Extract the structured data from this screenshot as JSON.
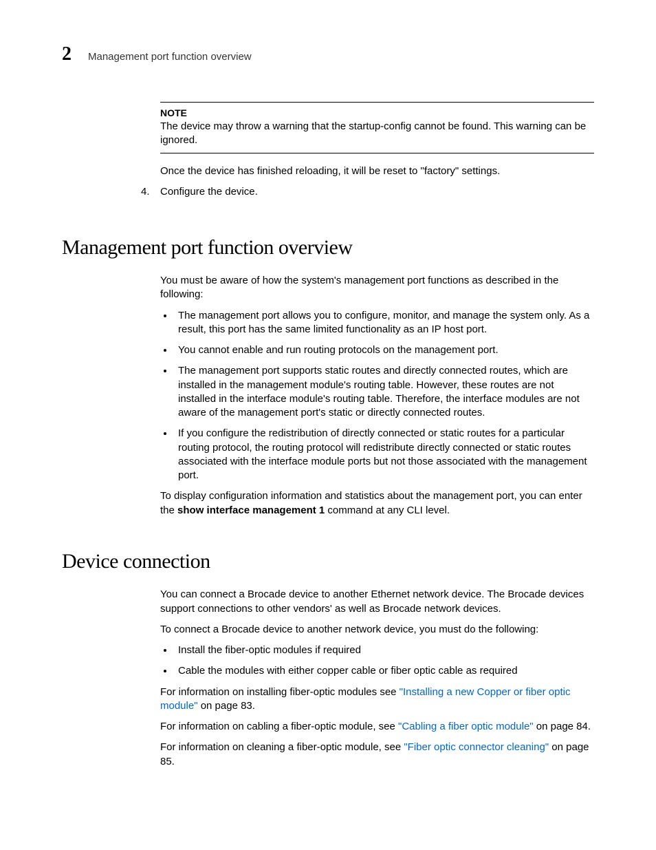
{
  "header": {
    "chapter_number": "2",
    "running_head": "Management port function overview"
  },
  "note": {
    "label": "NOTE",
    "text": "The device may throw a warning that the startup-config cannot be found. This warning can be ignored."
  },
  "after_note_para": "Once the device has finished reloading, it will be reset to \"factory\" settings.",
  "step4": {
    "num": "4.",
    "text": "Configure the device."
  },
  "section1": {
    "title": "Management port function overview",
    "intro": "You must be aware of how the system's management port functions as described in the following:",
    "bullets": [
      "The management port allows you to configure, monitor, and manage the system only. As a result, this port has the same limited functionality as an IP host port.",
      "You cannot enable and run routing protocols on the management port.",
      "The management port supports static routes and directly connected routes, which are installed in the management module's routing table. However, these routes are not installed in the interface module's routing table. Therefore, the interface modules are not aware of the management port's static or directly connected routes.",
      "If you configure the redistribution of directly connected or static routes for a particular routing protocol, the routing protocol will redistribute directly connected or static routes associated with the interface module ports but not those associated with the management port."
    ],
    "outro_pre": "To display configuration information and statistics about the management port, you can enter the ",
    "outro_cmd": "show interface management 1",
    "outro_post": " command at any CLI level."
  },
  "section2": {
    "title": "Device connection",
    "p1": "You can connect a Brocade device to another Ethernet network device. The Brocade devices support connections to other vendors' as well as Brocade network devices.",
    "p2": "To connect a Brocade device to another network device, you must do the following:",
    "bullets": [
      "Install the fiber-optic modules if required",
      "Cable the modules with either copper cable or fiber optic cable as required"
    ],
    "p3_pre": "For information on installing fiber-optic modules see ",
    "p3_link": "\"Installing a new Copper or fiber optic module\"",
    "p3_post": " on page 83.",
    "p4_pre": "For information on cabling a fiber-optic module, see ",
    "p4_link": "\"Cabling a fiber optic module\"",
    "p4_post": " on page 84.",
    "p5_pre": "For information on cleaning a fiber-optic module, see ",
    "p5_link": "\"Fiber optic connector cleaning\"",
    "p5_post": " on page 85."
  }
}
